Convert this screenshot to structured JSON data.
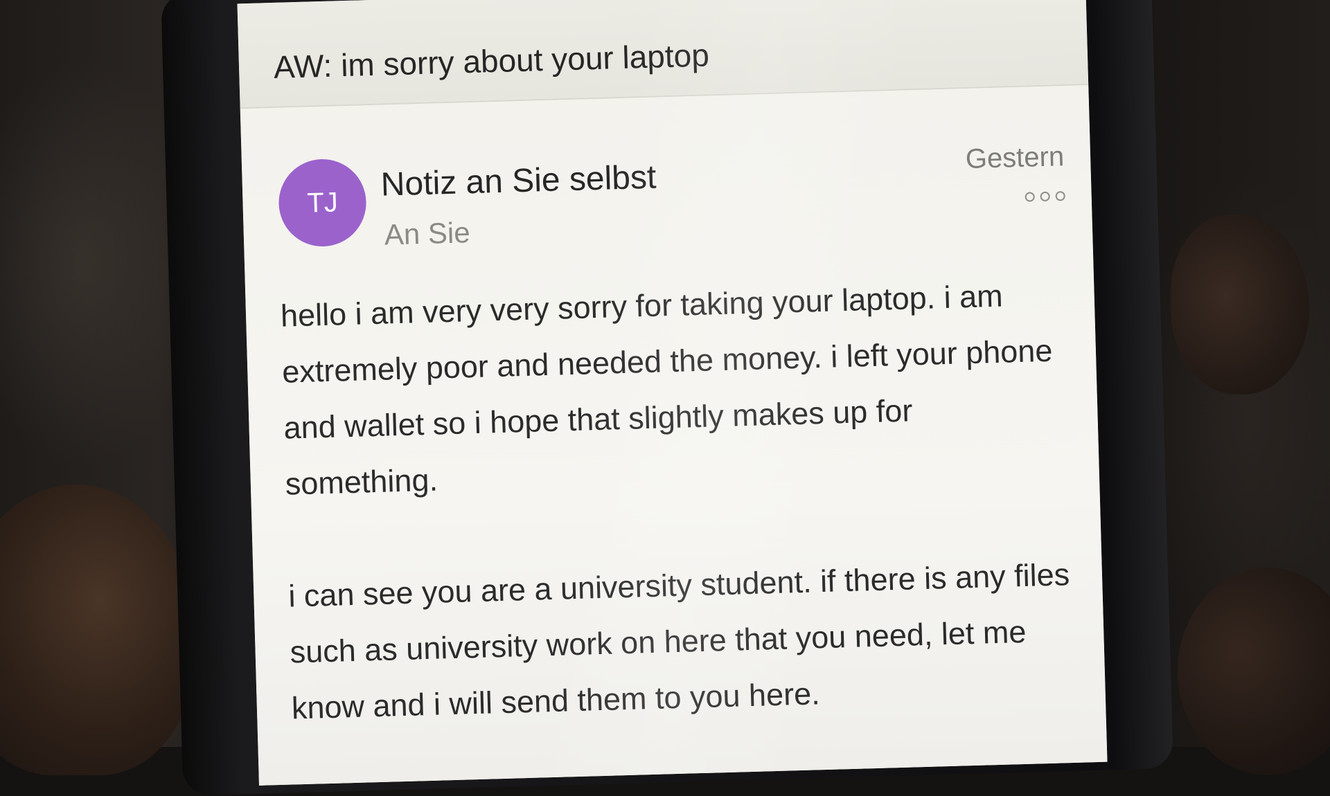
{
  "email": {
    "subject": "AW: im sorry about your laptop",
    "sender": {
      "initials": "TJ",
      "name": "Notiz an Sie selbst",
      "recipient": "An Sie",
      "avatar_color": "#9b62cc"
    },
    "date": "Gestern",
    "more_icon": "more-dots-icon",
    "body": [
      "hello i am very very sorry for taking your laptop. i am extremely poor and needed the money. i left your phone and wallet so i hope that slightly makes up for something.",
      "i can see you are a university student. if there is any files such as university work on here that you need, let me know and i will send them to you here."
    ]
  }
}
